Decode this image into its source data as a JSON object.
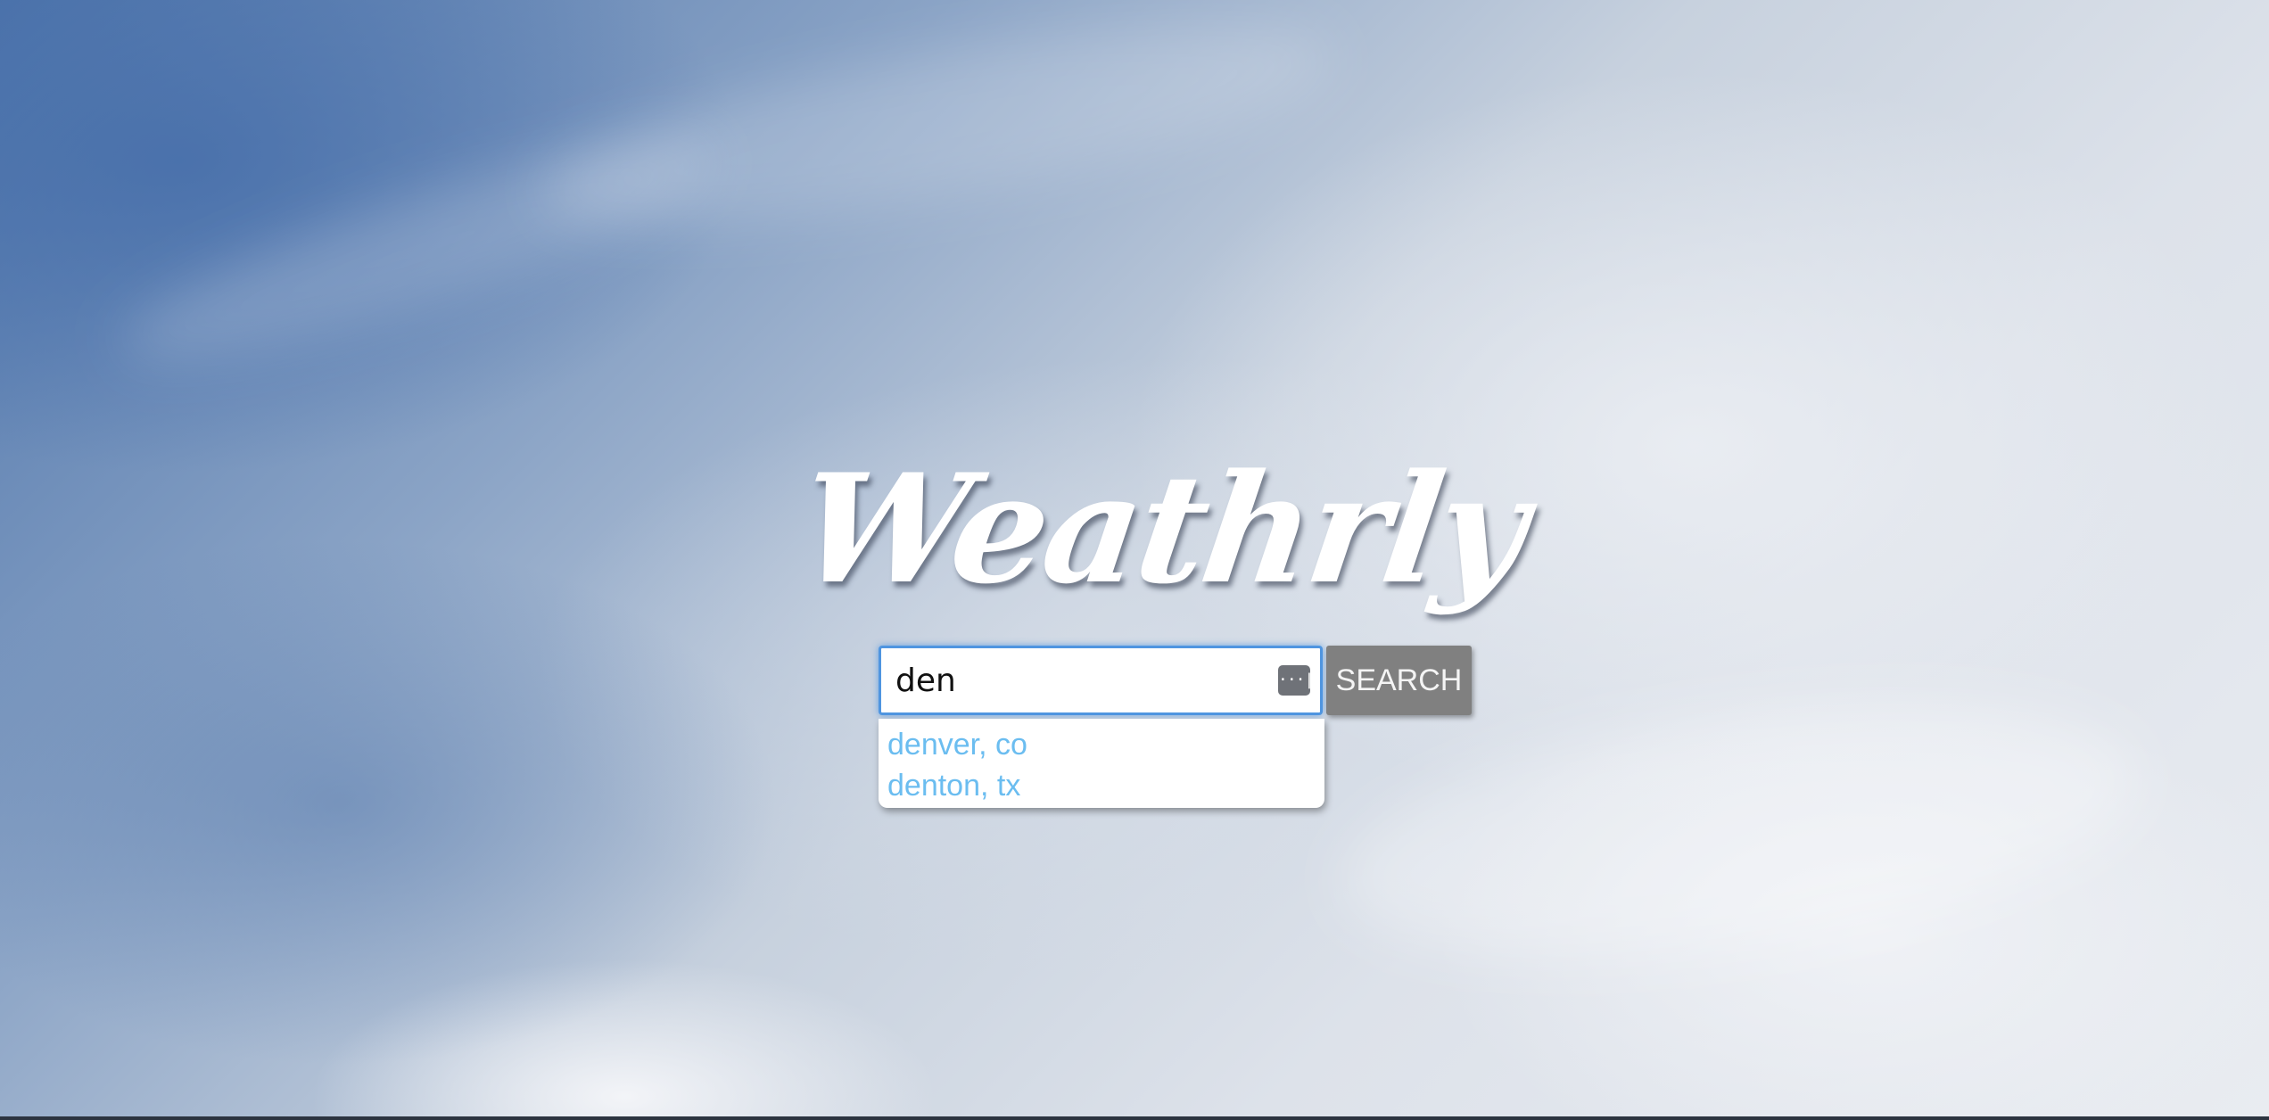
{
  "app": {
    "logo_text": "Weathrly"
  },
  "search": {
    "value": "den",
    "placeholder": "",
    "button_label": "SEARCH",
    "autofill_icon_glyph": "···|"
  },
  "suggestions": [
    "denver, co",
    "denton, tx"
  ],
  "colors": {
    "suggestion_text": "#6bbdf0",
    "button_bg": "#808080",
    "input_focus_border": "#4f95e0"
  },
  "icons": {
    "autofill": "autofill-key-icon"
  }
}
